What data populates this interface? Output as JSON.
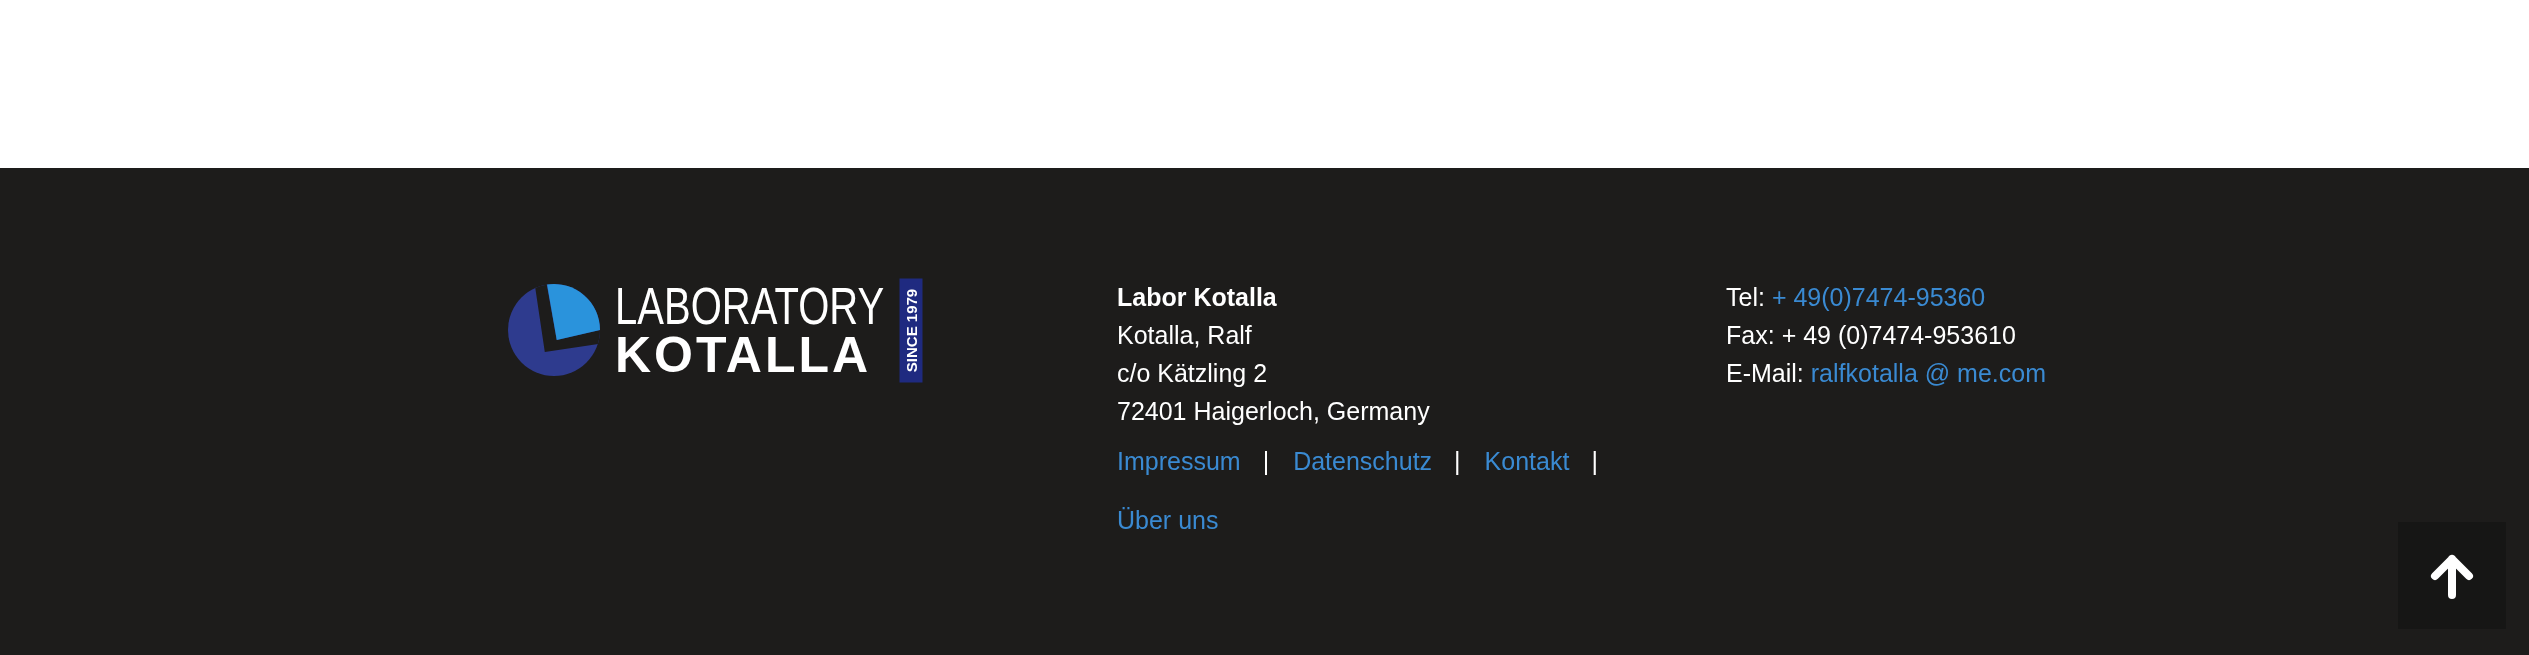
{
  "logo": {
    "line_1": "LABORATORY",
    "line_2": "KOTALLA",
    "tagline": "SINCE 1979"
  },
  "address": {
    "company": "Labor Kotalla",
    "lines": [
      "Kotalla, Ralf",
      "c/o Kätzling 2",
      "72401 Haigerloch, Germany"
    ]
  },
  "footer_links": [
    {
      "label": "Impressum",
      "separator": "|"
    },
    {
      "label": "Datenschutz",
      "separator": "|"
    },
    {
      "label": "Kontakt",
      "separator": "|"
    },
    {
      "label": "Über uns"
    }
  ],
  "contact": [
    {
      "label": "Tel:",
      "value": "+ 49(0)7474-95360",
      "kind": "link"
    },
    {
      "label": "Fax:",
      "value": "+ 49 (0)7474-953610",
      "kind": "text"
    },
    {
      "label": "E-Mail:",
      "value": "ralfkotalla @ me.com",
      "kind": "link"
    }
  ]
}
